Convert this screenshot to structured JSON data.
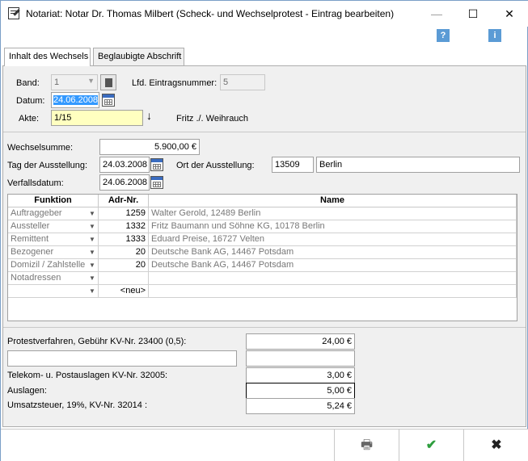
{
  "window": {
    "title": "Notariat: Notar Dr. Thomas Milbert (Scheck- und Wechselprotest - Eintrag bearbeiten)",
    "minimize": "—",
    "maximize": "☐",
    "close": "✕",
    "help_icon": "?",
    "info_icon": "i"
  },
  "tabs": [
    {
      "label": "Inhalt des Wechsels",
      "active": true
    },
    {
      "label": "Beglaubigte Abschrift",
      "active": false
    }
  ],
  "form": {
    "band_label": "Band:",
    "band_value": "1",
    "lfd_label": "Lfd. Eintragsnummer:",
    "lfd_value": "5",
    "datum_label": "Datum:",
    "datum_value": "24.06.2008",
    "akte_label": "Akte:",
    "akte_value": "1/15",
    "akte_arrow": "↓",
    "akte_parties": "Fritz ./. Weihrauch",
    "wechselsumme_label": "Wechselsumme:",
    "wechselsumme_value": "5.900,00 €",
    "tag_label": "Tag der Ausstellung:",
    "tag_value": "24.03.2008",
    "ort_label": "Ort der Ausstellung:",
    "ort_plz": "13509",
    "ort_name": "Berlin",
    "verfall_label": "Verfallsdatum:",
    "verfall_value": "24.06.2008"
  },
  "grid": {
    "headers": {
      "funktion": "Funktion",
      "adr": "Adr-Nr.",
      "name": "Name"
    },
    "rows": [
      {
        "funktion": "Auftraggeber",
        "adr": "1259",
        "name": "Walter Gerold, 12489 Berlin"
      },
      {
        "funktion": "Aussteller",
        "adr": "1332",
        "name": "Fritz Baumann und Söhne KG, 10178 Berlin"
      },
      {
        "funktion": "Remittent",
        "adr": "1333",
        "name": "Eduard Preise, 16727 Velten"
      },
      {
        "funktion": "Bezogener",
        "adr": "20",
        "name": "Deutsche Bank AG, 14467 Potsdam"
      },
      {
        "funktion": "Domizil / Zahlstelle",
        "adr": "20",
        "name": "Deutsche Bank AG, 14467 Potsdam"
      },
      {
        "funktion": "Notadressen",
        "adr": "",
        "name": ""
      },
      {
        "funktion": "",
        "adr": "<neu>",
        "name": ""
      }
    ]
  },
  "fees": {
    "protest_label": "Protestverfahren, Gebühr KV-Nr. 23400 (0,5):",
    "protest_value": "24,00 €",
    "extra_text": "",
    "extra_value": "",
    "telekom_label": "Telekom- u. Postauslagen KV-Nr. 32005:",
    "telekom_value": "3,00 €",
    "auslagen_label": "Auslagen:",
    "auslagen_value": "5,00 €",
    "ust_label": "Umsatzsteuer, 19%, KV-Nr. 32014 :",
    "ust_value": "5,24 €"
  },
  "buttons": {
    "print": "🖶",
    "ok": "✔",
    "cancel": "✖"
  },
  "colors": {
    "ok_green": "#2e9e3e",
    "cancel_dark": "#222222",
    "selection_blue": "#3399ff",
    "akte_yellow": "#ffffc0"
  }
}
